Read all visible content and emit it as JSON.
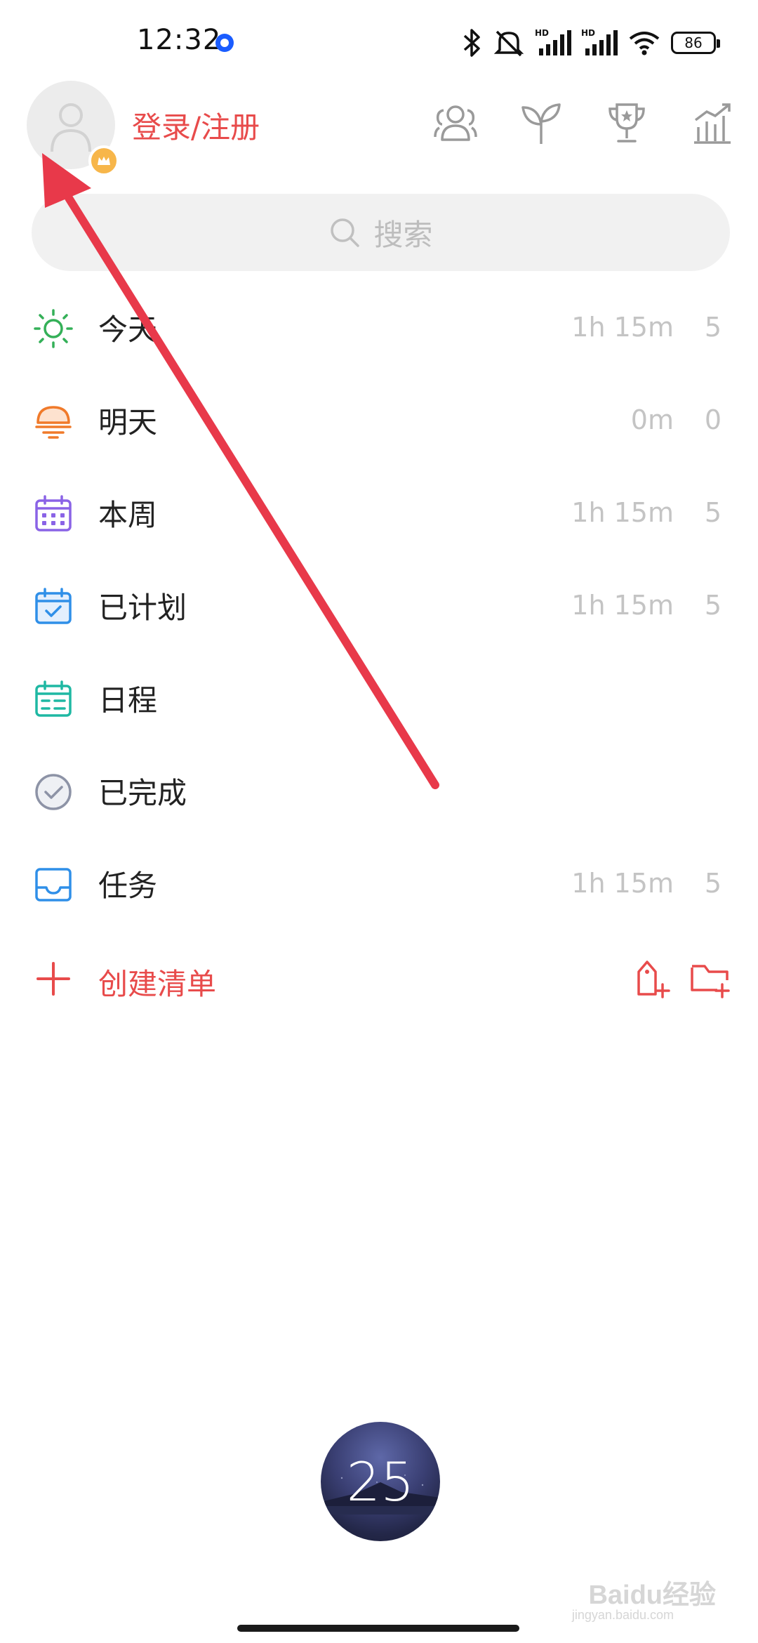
{
  "status_bar": {
    "time": "12:32",
    "battery": "86",
    "icons": [
      "bluetooth-icon",
      "mute-icon",
      "hd-signal-1-icon",
      "hd-signal-2-icon",
      "wifi-icon",
      "battery-icon"
    ]
  },
  "header": {
    "login_label": "登录/注册",
    "icons": [
      "group-icon",
      "sprout-icon",
      "trophy-icon",
      "stats-icon"
    ]
  },
  "search": {
    "placeholder": "搜索"
  },
  "nav_items": [
    {
      "label": "今天",
      "duration": "1h 15m",
      "count": "5",
      "icon": "sun-icon",
      "color": "#34b058"
    },
    {
      "label": "明天",
      "duration": "0m",
      "count": "0",
      "icon": "sunset-icon",
      "color": "#f07a2a"
    },
    {
      "label": "本周",
      "duration": "1h 15m",
      "count": "5",
      "icon": "calendar-week-icon",
      "color": "#8a63e6"
    },
    {
      "label": "已计划",
      "duration": "1h 15m",
      "count": "5",
      "icon": "calendar-check-icon",
      "color": "#2f8fe8"
    },
    {
      "label": "日程",
      "duration": "",
      "count": "",
      "icon": "calendar-schedule-icon",
      "color": "#1fb8a3"
    },
    {
      "label": "已完成",
      "duration": "",
      "count": "",
      "icon": "check-circle-icon",
      "color": "#8d93a6"
    },
    {
      "label": "任务",
      "duration": "1h 15m",
      "count": "5",
      "icon": "inbox-icon",
      "color": "#2f8fe8"
    }
  ],
  "create": {
    "label": "创建清单",
    "color": "#e84b4b"
  },
  "timer": {
    "value": "25"
  },
  "watermark": {
    "text": "Baidu经验",
    "sub": "jingyan.baidu.com"
  },
  "colors": {
    "accent": "#e84b4b",
    "annotation_arrow": "#e8394a"
  }
}
